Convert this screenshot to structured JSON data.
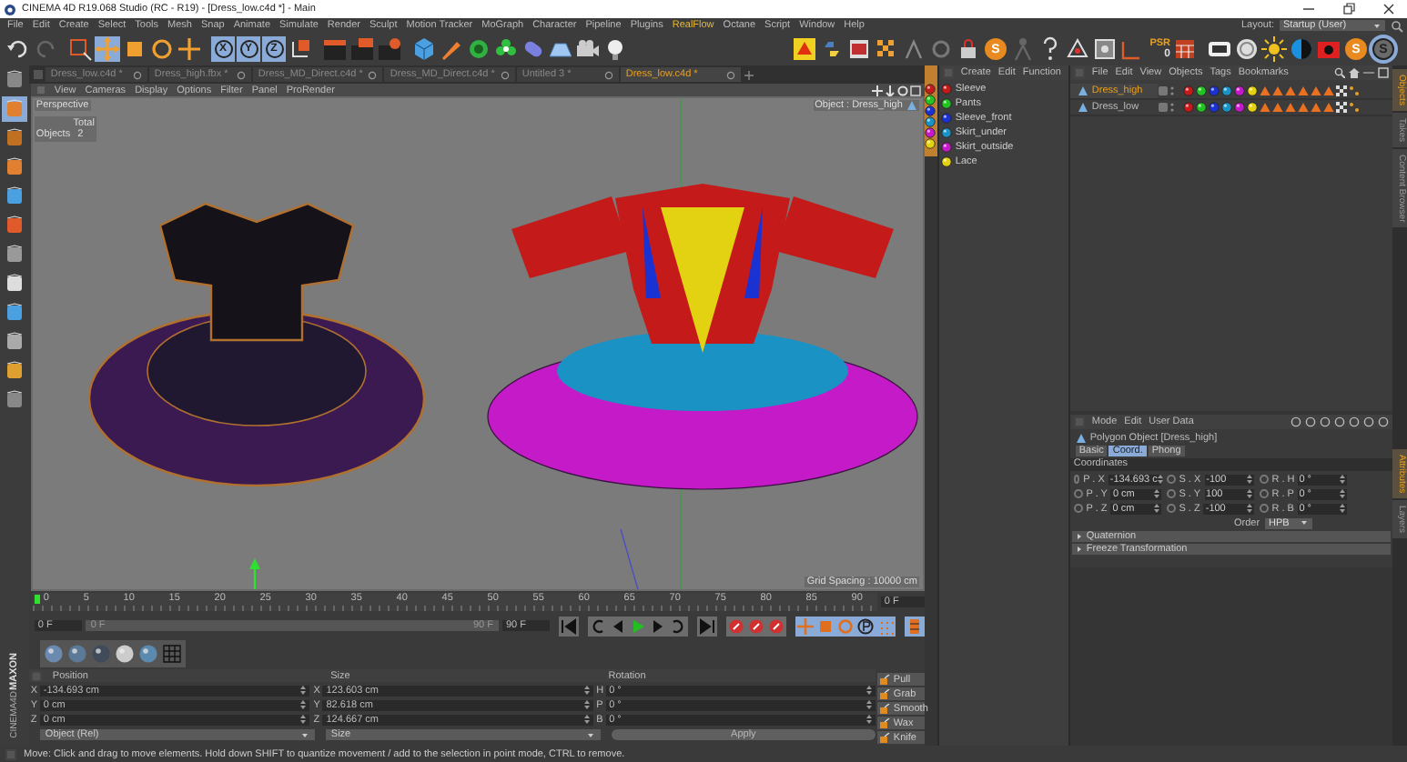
{
  "window": {
    "title": "CINEMA 4D R19.068 Studio (RC - R19) - [Dress_low.c4d *] - Main"
  },
  "menu": [
    {
      "label": "File",
      "highlighted": false
    },
    {
      "label": "Edit",
      "highlighted": false
    },
    {
      "label": "Create",
      "highlighted": false
    },
    {
      "label": "Select",
      "highlighted": false
    },
    {
      "label": "Tools",
      "highlighted": false
    },
    {
      "label": "Mesh",
      "highlighted": false
    },
    {
      "label": "Snap",
      "highlighted": false
    },
    {
      "label": "Animate",
      "highlighted": false
    },
    {
      "label": "Simulate",
      "highlighted": false
    },
    {
      "label": "Render",
      "highlighted": false
    },
    {
      "label": "Sculpt",
      "highlighted": false
    },
    {
      "label": "Motion Tracker",
      "highlighted": false
    },
    {
      "label": "MoGraph",
      "highlighted": false
    },
    {
      "label": "Character",
      "highlighted": false
    },
    {
      "label": "Pipeline",
      "highlighted": false
    },
    {
      "label": "Plugins",
      "highlighted": false
    },
    {
      "label": "RealFlow",
      "highlighted": true
    },
    {
      "label": "Octane",
      "highlighted": false
    },
    {
      "label": "Script",
      "highlighted": false
    },
    {
      "label": "Window",
      "highlighted": false
    },
    {
      "label": "Help",
      "highlighted": false
    }
  ],
  "layout": {
    "label": "Layout:",
    "value": "Startup (User)"
  },
  "toolbar": {
    "axis_buttons": [
      "X",
      "Y",
      "Z"
    ],
    "psr_label": "PSR",
    "psr_value": "0",
    "script_letter": "S",
    "panel_letters": [
      "S",
      "S"
    ]
  },
  "doc_tabs": [
    {
      "label": "Dress_low.c4d *",
      "selected": false
    },
    {
      "label": "Dress_high.fbx *",
      "selected": false
    },
    {
      "label": "Dress_MD_Direct.c4d *",
      "selected": false
    },
    {
      "label": "Dress_MD_Direct.c4d *",
      "selected": false
    },
    {
      "label": "Untitled 3 *",
      "selected": false
    },
    {
      "label": "Dress_low.c4d *",
      "selected": true
    }
  ],
  "viewport": {
    "menu": [
      "View",
      "Cameras",
      "Display",
      "Options",
      "Filter",
      "Panel",
      "ProRender"
    ],
    "camera": "Perspective",
    "hud": {
      "header": "Total",
      "rows": [
        {
          "label": "Objects",
          "value": "2"
        }
      ]
    },
    "object_label": "Object : Dress_high",
    "grid_spacing": "Grid Spacing : 10000 cm"
  },
  "material_manager": {
    "menu": [
      "Create",
      "Edit",
      "Function"
    ],
    "materials": [
      {
        "name": "Sleeve",
        "color": "#c41a1a"
      },
      {
        "name": "Pants",
        "color": "#22c422"
      },
      {
        "name": "Sleeve_front",
        "color": "#1a32d2"
      },
      {
        "name": "Skirt_under",
        "color": "#1a92c4"
      },
      {
        "name": "Skirt_outside",
        "color": "#c41ac8"
      },
      {
        "name": "Lace",
        "color": "#e2d212"
      }
    ]
  },
  "object_manager": {
    "menu": [
      "File",
      "Edit",
      "View",
      "Objects",
      "Tags",
      "Bookmarks"
    ],
    "objects": [
      {
        "name": "Dress_high",
        "selected": true
      },
      {
        "name": "Dress_low",
        "selected": false
      }
    ]
  },
  "side_tabs_top": [
    {
      "label": "Objects",
      "selected": true
    },
    {
      "label": "Takes",
      "selected": false
    },
    {
      "label": "Content Browser",
      "selected": false
    }
  ],
  "side_tabs_bottom": [
    {
      "label": "Attributes",
      "selected": true
    },
    {
      "label": "Layers",
      "selected": false
    }
  ],
  "attributes": {
    "menu": [
      "Mode",
      "Edit",
      "User Data"
    ],
    "object": "Polygon Object [Dress_high]",
    "tabs": [
      {
        "label": "Basic",
        "selected": false
      },
      {
        "label": "Coord.",
        "selected": true
      },
      {
        "label": "Phong",
        "selected": false
      }
    ],
    "section": "Coordinates",
    "rows": [
      [
        {
          "label": "P . X",
          "value": "-134.693 c"
        },
        {
          "label": "S . X",
          "value": "-100"
        },
        {
          "label": "R . H",
          "value": "0 °"
        }
      ],
      [
        {
          "label": "P . Y",
          "value": "0 cm"
        },
        {
          "label": "S . Y",
          "value": "100"
        },
        {
          "label": "R . P",
          "value": "0 °"
        }
      ],
      [
        {
          "label": "P . Z",
          "value": "0 cm"
        },
        {
          "label": "S . Z",
          "value": "-100"
        },
        {
          "label": "R . B",
          "value": "0 °"
        }
      ]
    ],
    "order_label": "Order",
    "order_value": "HPB",
    "groups": [
      "Quaternion",
      "Freeze Transformation"
    ]
  },
  "timeline": {
    "ticks": [
      "0",
      "5",
      "10",
      "15",
      "20",
      "25",
      "30",
      "35",
      "40",
      "45",
      "50",
      "55",
      "60",
      "65",
      "70",
      "75",
      "80",
      "85",
      "90"
    ],
    "current_frame": "0 F",
    "start": "0 F",
    "range": {
      "start": "0 F",
      "end": "90 F",
      "level": 1
    },
    "end": "90 F"
  },
  "coordinates": {
    "columns": [
      "Position",
      "Size",
      "Rotation"
    ],
    "rows": [
      [
        {
          "axis": "X",
          "value": "-134.693 cm"
        },
        {
          "axis": "X",
          "value": "123.603 cm"
        },
        {
          "axis": "H",
          "value": "0 °"
        }
      ],
      [
        {
          "axis": "Y",
          "value": "0 cm"
        },
        {
          "axis": "Y",
          "value": "82.618 cm"
        },
        {
          "axis": "P",
          "value": "0 °"
        }
      ],
      [
        {
          "axis": "Z",
          "value": "0 cm"
        },
        {
          "axis": "Z",
          "value": "124.667 cm"
        },
        {
          "axis": "B",
          "value": "0 °"
        }
      ]
    ],
    "mode": "Object (Rel)",
    "size_mode": "Size",
    "apply": "Apply"
  },
  "sculpt_tools": [
    "Pull",
    "Grab",
    "Smooth",
    "Wax",
    "Knife"
  ],
  "logo": {
    "brand": "MAXON",
    "product": "CINEMA4D"
  },
  "status_bar": "Move: Click and drag to move elements. Hold down SHIFT to quantize movement / add to the selection in point mode, CTRL to remove."
}
